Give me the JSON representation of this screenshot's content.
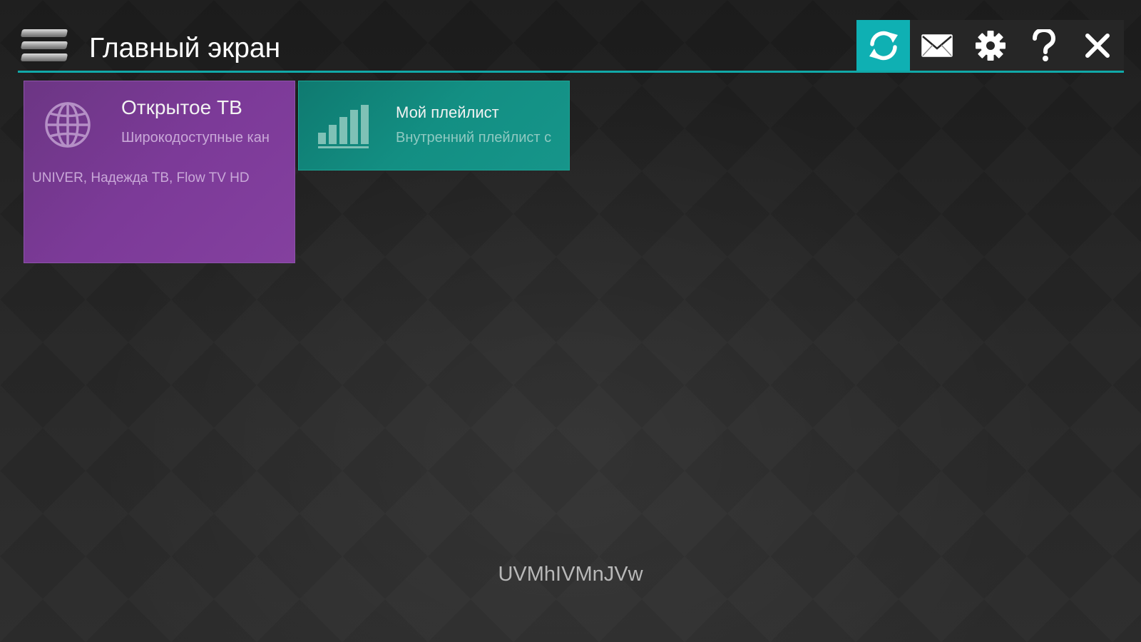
{
  "header": {
    "title": "Главный экран",
    "menu_icon": "hamburger-menu-icon",
    "toolbar": [
      {
        "name": "refresh-button",
        "icon": "refresh-icon",
        "active": true
      },
      {
        "name": "messages-button",
        "icon": "envelope-icon",
        "active": false
      },
      {
        "name": "settings-button",
        "icon": "gear-icon",
        "active": false
      },
      {
        "name": "help-button",
        "icon": "question-icon",
        "active": false
      },
      {
        "name": "close-button",
        "icon": "close-icon",
        "active": false
      }
    ]
  },
  "tiles": [
    {
      "title": "Открытое ТВ",
      "subtitle": "Широкодоступные кан",
      "description": "UNIVER, Надежда ТВ, Flow TV HD",
      "icon": "globe-icon",
      "color": "#7c3a98"
    },
    {
      "title": "Мой плейлист",
      "subtitle": "Внутренний плейлист с",
      "icon": "signal-bars-icon",
      "color": "#138f83"
    }
  ],
  "footer": {
    "code": "UVMhIVMnJVw"
  },
  "colors": {
    "accent": "#11a9a8",
    "background": "#232323"
  }
}
